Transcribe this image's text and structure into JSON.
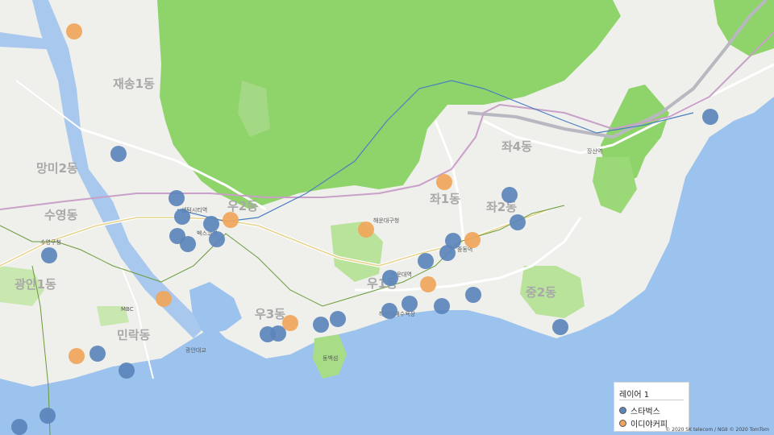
{
  "legend": {
    "title": "레이어 1",
    "items": [
      {
        "label": "스타벅스",
        "color": "#5b86bb"
      },
      {
        "label": "이디야커피",
        "color": "#f0a65a"
      }
    ]
  },
  "attribution": "© 2020 SK telecom / NGII  © 2020 TomTom",
  "districts": [
    "재송1동",
    "망미2동",
    "수영동",
    "광안1동",
    "민락동",
    "우2동",
    "우3동",
    "우1동",
    "좌4동",
    "좌1동",
    "좌2동",
    "중2동"
  ],
  "places": [
    "수영구청",
    "해운대구청",
    "해운대역",
    "동백섬",
    "해운대해수욕장",
    "장산역",
    "중동역",
    "벡스코역",
    "센텀시티역",
    "MBC",
    "광안대교"
  ],
  "colors": {
    "land": "#efefec",
    "mountain": "#8fd46a",
    "water": "#9cc2ee",
    "river": "#a8c8ee",
    "starbucks": "#5b86bb",
    "ediya": "#f0a65a"
  }
}
